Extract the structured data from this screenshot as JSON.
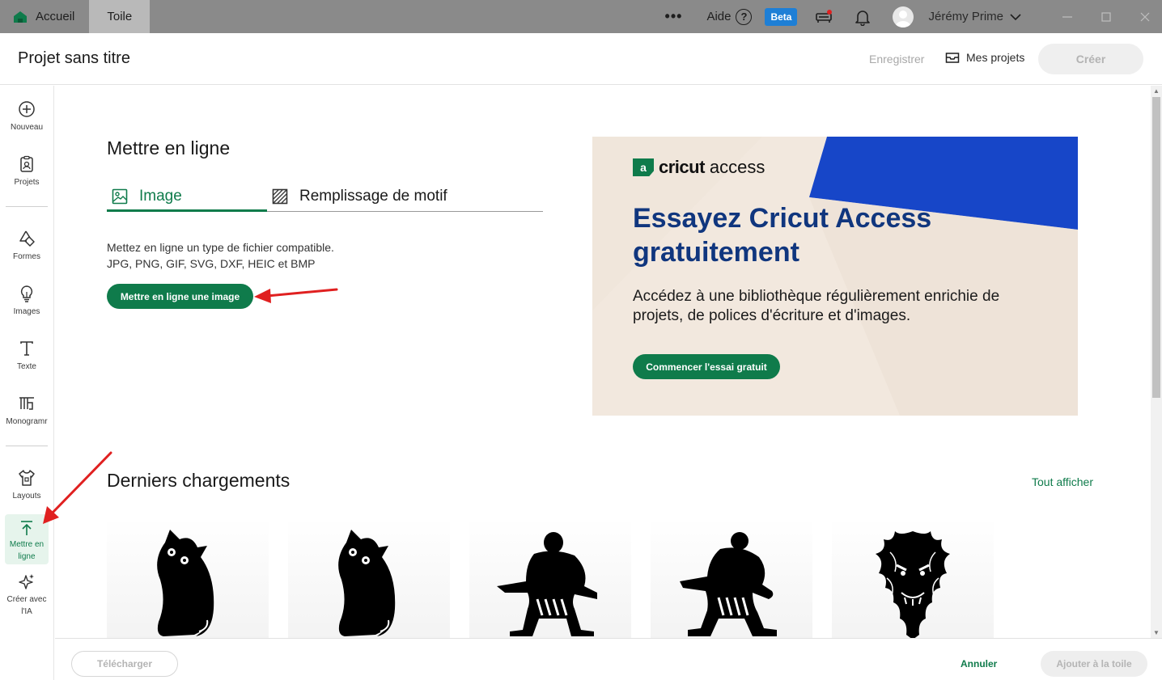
{
  "titlebar": {
    "tabs": [
      {
        "label": "Accueil"
      },
      {
        "label": "Toile"
      }
    ],
    "more_label": "•••",
    "help_label": "Aide",
    "help_glyph": "?",
    "beta_label": "Beta",
    "user_name": "Jérémy Prime"
  },
  "header": {
    "project_title": "Projet sans titre",
    "save_label": "Enregistrer",
    "my_projects_label": "Mes projets",
    "create_label": "Créer"
  },
  "sidebar": {
    "items": [
      {
        "label": "Nouveau",
        "icon": "plus-circle-icon"
      },
      {
        "label": "Projets",
        "icon": "projects-icon"
      },
      {
        "label": "Formes",
        "icon": "shapes-icon"
      },
      {
        "label": "Images",
        "icon": "lightbulb-icon"
      },
      {
        "label": "Texte",
        "icon": "text-icon"
      },
      {
        "label": "Monogramr",
        "icon": "monogram-icon"
      },
      {
        "label": "Layouts",
        "icon": "tshirt-icon"
      },
      {
        "label": "Mettre en ligne",
        "icon": "upload-icon",
        "active": true
      },
      {
        "label": "Créer avec l'IA",
        "icon": "sparkle-icon"
      }
    ]
  },
  "upload": {
    "title": "Mettre en ligne",
    "tabs": [
      {
        "label": "Image",
        "active": true
      },
      {
        "label": "Remplissage de motif",
        "active": false
      }
    ],
    "description_line1": "Mettez en ligne un type de fichier compatible.",
    "description_line2": "JPG, PNG, GIF, SVG, DXF, HEIC et BMP",
    "button_label": "Mettre en ligne une image"
  },
  "promo": {
    "logo_mark": "a",
    "logo_brand": "cricut",
    "logo_product": "access",
    "title": "Essayez Cricut Access gratuitement",
    "subtitle": "Accédez à une bibliothèque régulièrement enrichie de projets, de polices d'écriture et d'images.",
    "button_label": "Commencer l'essai gratuit"
  },
  "recent": {
    "title": "Derniers chargements",
    "see_all_label": "Tout afficher",
    "items": [
      {
        "icon": "cat-silhouette-icon"
      },
      {
        "icon": "cat-silhouette-icon"
      },
      {
        "icon": "sumo-wrestler-icon"
      },
      {
        "icon": "sumo-wrestler-icon"
      },
      {
        "icon": "dragon-head-icon"
      }
    ]
  },
  "footer": {
    "download_label": "Télécharger",
    "cancel_label": "Annuler",
    "add_label": "Ajouter à la toile"
  },
  "colors": {
    "brand_green": "#0f7b4b",
    "promo_navy": "#10367e",
    "promo_blue": "#1746c8",
    "promo_bg": "#f2e8de",
    "titlebar_bg": "#8a8a8a",
    "annotation_red": "#e02020"
  }
}
